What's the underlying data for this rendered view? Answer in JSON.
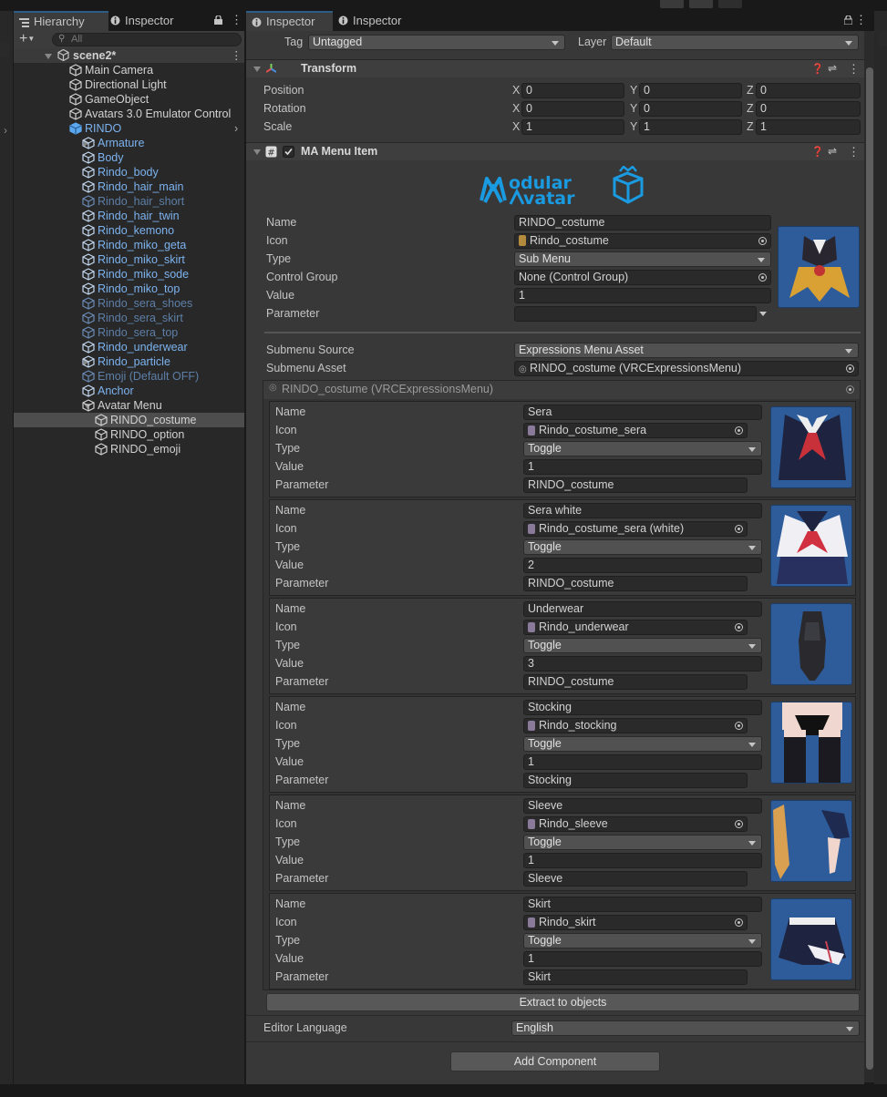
{
  "hierarchy": {
    "tabs": [
      {
        "label": "Hierarchy"
      },
      {
        "label": "Inspector"
      }
    ],
    "search_placeholder": "All",
    "scene": "scene2*",
    "rows": [
      {
        "label": "Main Camera"
      },
      {
        "label": "Directional Light"
      },
      {
        "label": "GameObject"
      },
      {
        "label": "Avatars 3.0 Emulator Control"
      },
      {
        "label": "RINDO"
      },
      {
        "label": "Armature"
      },
      {
        "label": "Body"
      },
      {
        "label": "Rindo_body"
      },
      {
        "label": "Rindo_hair_main"
      },
      {
        "label": "Rindo_hair_short"
      },
      {
        "label": "Rindo_hair_twin"
      },
      {
        "label": "Rindo_kemono"
      },
      {
        "label": "Rindo_miko_geta"
      },
      {
        "label": "Rindo_miko_skirt"
      },
      {
        "label": "Rindo_miko_sode"
      },
      {
        "label": "Rindo_miko_top"
      },
      {
        "label": "Rindo_sera_shoes"
      },
      {
        "label": "Rindo_sera_skirt"
      },
      {
        "label": "Rindo_sera_top"
      },
      {
        "label": "Rindo_underwear"
      },
      {
        "label": "Rindo_particle"
      },
      {
        "label": "Emoji (Default OFF)"
      },
      {
        "label": "Anchor"
      },
      {
        "label": "Avatar Menu"
      },
      {
        "label": "RINDO_costume"
      },
      {
        "label": "RINDO_option"
      },
      {
        "label": "RINDO_emoji"
      }
    ]
  },
  "inspector": {
    "tabs": [
      {
        "label": "Inspector"
      },
      {
        "label": "Inspector"
      }
    ],
    "tag_label": "Tag",
    "tag_value": "Untagged",
    "layer_label": "Layer",
    "layer_value": "Default",
    "transform": {
      "title": "Transform",
      "rows": [
        {
          "label": "Position",
          "x": "0",
          "y": "0",
          "z": "0"
        },
        {
          "label": "Rotation",
          "x": "0",
          "y": "0",
          "z": "0"
        },
        {
          "label": "Scale",
          "x": "1",
          "y": "1",
          "z": "1"
        }
      ],
      "axes": [
        "X",
        "Y",
        "Z"
      ]
    },
    "menu_item": {
      "title": "MA Menu Item",
      "logo_line1": "odular",
      "logo_line2": "vatar",
      "name_label": "Name",
      "name_value": "RINDO_costume",
      "icon_label": "Icon",
      "icon_value": "Rindo_costume",
      "type_label": "Type",
      "type_value": "Sub Menu",
      "control_label": "Control Group",
      "control_value": "None (Control Group)",
      "value_label": "Value",
      "value_value": "1",
      "param_label": "Parameter",
      "param_value": "",
      "source_label": "Submenu Source",
      "source_value": "Expressions Menu Asset",
      "asset_label": "Submenu Asset",
      "asset_value": "RINDO_costume (VRCExpressionsMenu)",
      "sub_header": "RINDO_costume (VRCExpressionsMenu)",
      "labels": {
        "name": "Name",
        "icon": "Icon",
        "type": "Type",
        "value": "Value",
        "param": "Parameter"
      },
      "items": [
        {
          "name": "Sera",
          "icon": "Rindo_costume_sera",
          "type": "Toggle",
          "value": "1",
          "param": "RINDO_costume",
          "thumb": "sera"
        },
        {
          "name": "Sera white",
          "icon": "Rindo_costume_sera (white)",
          "type": "Toggle",
          "value": "2",
          "param": "RINDO_costume",
          "thumb": "sera_white"
        },
        {
          "name": "Underwear",
          "icon": "Rindo_underwear",
          "type": "Toggle",
          "value": "3",
          "param": "RINDO_costume",
          "thumb": "underwear"
        },
        {
          "name": "Stocking",
          "icon": "Rindo_stocking",
          "type": "Toggle",
          "value": "1",
          "param": "Stocking",
          "thumb": "stocking"
        },
        {
          "name": "Sleeve",
          "icon": "Rindo_sleeve",
          "type": "Toggle",
          "value": "1",
          "param": "Sleeve",
          "thumb": "sleeve"
        },
        {
          "name": "Skirt",
          "icon": "Rindo_skirt",
          "type": "Toggle",
          "value": "1",
          "param": "Skirt",
          "thumb": "skirt"
        }
      ],
      "extract_label": "Extract to objects",
      "lang_label": "Editor Language",
      "lang_value": "English"
    },
    "add_component": "Add Component"
  },
  "colors": {
    "accent": "#2c5d87",
    "link_blue": "#7cb3f0",
    "thumb_bg": "#2e5b99",
    "logo_blue": "#1a9ae0"
  }
}
